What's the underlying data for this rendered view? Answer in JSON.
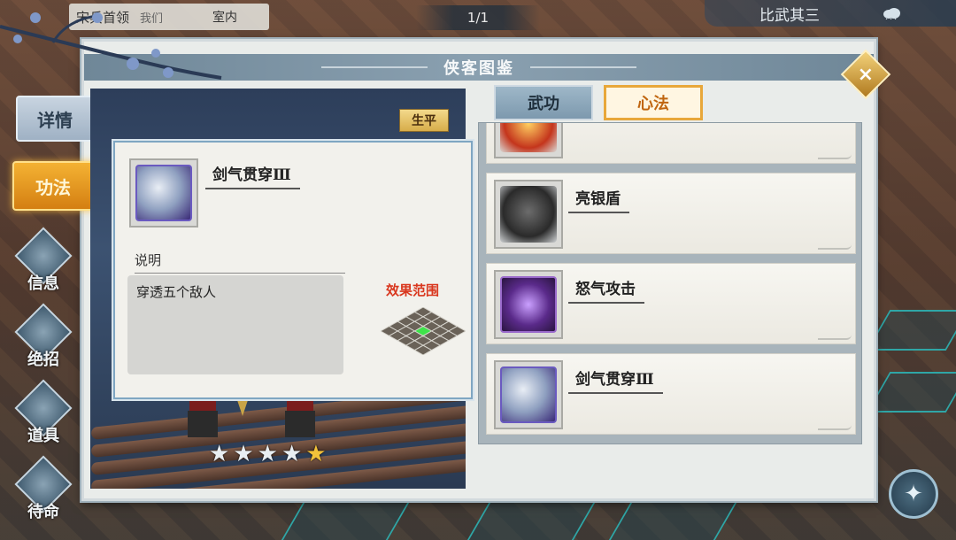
{
  "hud": {
    "name_primary": "宋兵首领",
    "name_secondary": "我们",
    "location": "室内",
    "page_indicator": "1/1",
    "event_title": "比武其三"
  },
  "side_menu": {
    "details": "详情",
    "skills": "功法",
    "items": [
      {
        "label": "信息",
        "icon": "info-diamond-icon"
      },
      {
        "label": "绝招",
        "icon": "ultimate-diamond-icon"
      },
      {
        "label": "道具",
        "icon": "item-diamond-icon"
      },
      {
        "label": "待命",
        "icon": "standby-diamond-icon"
      }
    ]
  },
  "panel": {
    "title": "侠客图鉴",
    "biography_badge": "生平",
    "stars": {
      "silver": 4,
      "gold": 1,
      "total": 5
    }
  },
  "detail": {
    "skill_name": "剑气贯穿Ⅲ",
    "skill_icon": "white-tiger-icon",
    "description_label": "说明",
    "description": "穿透五个敌人",
    "range_label": "效果范围",
    "range_grid": {
      "rows": 5,
      "cols": 5,
      "highlight_cell": [
        2,
        2
      ],
      "highlight_color": "#3ee34a"
    }
  },
  "tabs": {
    "martial": "武功",
    "mind": "心法"
  },
  "skill_list": [
    {
      "name": "",
      "icon": "flame-staff-icon"
    },
    {
      "name": "亮银盾",
      "icon": "silver-shield-icon"
    },
    {
      "name": "怒气攻击",
      "icon": "rage-attack-icon"
    },
    {
      "name": "剑气贯穿Ⅲ",
      "icon": "white-tiger-icon"
    }
  ],
  "colors": {
    "accent_gold": "#e8a73a",
    "panel_blue": "#6f8798",
    "range_red": "#d9371e"
  }
}
